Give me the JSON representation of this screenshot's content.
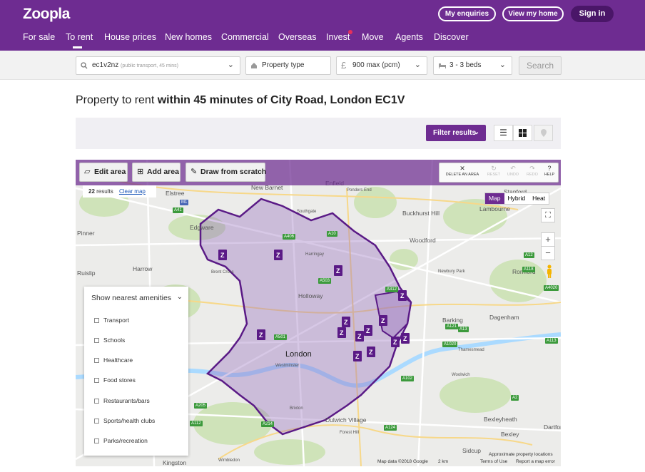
{
  "header": {
    "logo": "Zoopla",
    "my_enquiries": "My enquiries",
    "view_my_home": "View my home",
    "sign_in": "Sign in",
    "nav": [
      "For sale",
      "To rent",
      "House prices",
      "New homes",
      "Commercial",
      "Overseas",
      "Invest",
      "Move",
      "Agents",
      "Discover"
    ],
    "active_nav": "To rent",
    "accent": "#6e2c91"
  },
  "search": {
    "location_value": "ec1v2nz",
    "location_sub": "(public transport, 45 mins)",
    "property_type": "Property type",
    "price": "900 max (pcm)",
    "beds": "3 - 3 beds",
    "search_label": "Search"
  },
  "heading": {
    "prefix": "Property to rent",
    "bold": "within 45 minutes of City Road, London EC1V"
  },
  "filters": {
    "filter_results": "Filter results",
    "views": [
      "list-view-icon",
      "grid-view-icon",
      "map-pin-icon"
    ]
  },
  "map": {
    "tools": {
      "edit_area": "Edit area",
      "add_area": "Add area",
      "draw_from_scratch": "Draw from scratch",
      "delete_an_area": "DELETE AN AREA",
      "reset": "RESET",
      "undo": "UNDO",
      "redo": "REDO",
      "help": "HELP"
    },
    "results_count": "22",
    "results_label": "results",
    "clear_map": "Clear map",
    "map_types": [
      "Map",
      "Hybrid",
      "Heat"
    ],
    "active_map_type": "Map",
    "amenities": {
      "title": "Show nearest amenities",
      "items": [
        "Transport",
        "Schools",
        "Healthcare",
        "Food stores",
        "Restaurants/bars",
        "Sports/health clubs",
        "Parks/recreation"
      ]
    },
    "place_labels": [
      "Elstree",
      "New Barnet",
      "Enfield",
      "Ponders End",
      "Southgate",
      "Buckhurst Hill",
      "Lambourne",
      "Edgware",
      "Woodford",
      "Harringay",
      "Harrow",
      "Holloway",
      "Romford",
      "Ruislip",
      "London",
      "Westminster",
      "Dagenham",
      "Barking",
      "Woolwich",
      "Brixton",
      "Bexleyheath",
      "Dulwich Village",
      "Forest Hill",
      "Bexley",
      "Dartford",
      "Sidcup",
      "Wimbledon",
      "Kingston",
      "Newbury Park",
      "Brent Cross",
      "Stanford",
      "Thamesmead",
      "Pinner"
    ],
    "road_labels": [
      "A41",
      "M1",
      "A10",
      "A406",
      "A503",
      "A501",
      "A13",
      "A1020",
      "A102",
      "A2",
      "A205",
      "A214",
      "A12",
      "A118",
      "A124",
      "A4020",
      "A312",
      "A112",
      "A113",
      "A121"
    ],
    "attribution": {
      "data": "Map data ©2018 Google",
      "scale": "2 km",
      "terms": "Terms of Use",
      "report": "Report a map error",
      "approx": "Approximate property locations"
    }
  }
}
